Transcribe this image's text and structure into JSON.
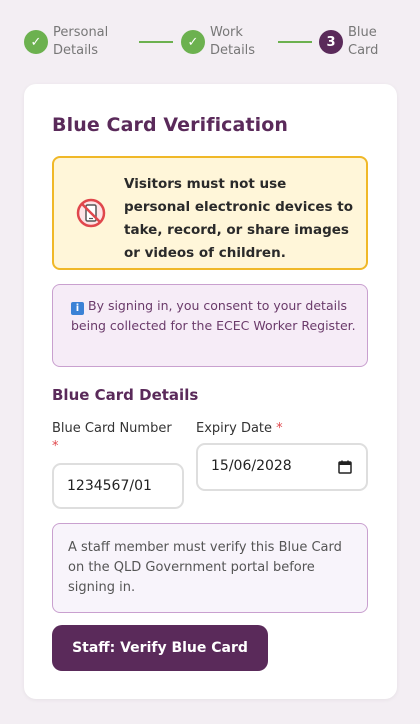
{
  "stepper": {
    "steps": [
      {
        "line1": "Personal",
        "line2": "Details",
        "status": "done",
        "marker": "✓"
      },
      {
        "line1": "Work",
        "line2": "Details",
        "status": "done",
        "marker": "✓"
      },
      {
        "line1": "Blue",
        "line2": "Card",
        "status": "active",
        "marker": "3"
      }
    ]
  },
  "card": {
    "title": "Blue Card Verification",
    "warning": {
      "icon": "no-phone-icon",
      "text": "Visitors must not use personal electronic devices to take, record, or share images or videos of children."
    },
    "consent": {
      "icon": "info-icon",
      "icon_glyph": "i",
      "text": "By signing in, you consent to your details being collected for the ECEC Worker Register."
    },
    "section_title": "Blue Card Details",
    "blue_card_number": {
      "label": "Blue Card Number",
      "required_mark": "*",
      "value": "1234567/01"
    },
    "expiry_date": {
      "label": "Expiry Date",
      "required_mark": "*",
      "value": "15/06/2028"
    },
    "staff_note": "A staff member must verify this Blue Card on the QLD Government portal before signing in.",
    "verify_button_label": "Staff: Verify Blue Card"
  },
  "colors": {
    "brand": "#5a2a5a",
    "step_done": "#6cb14f",
    "warning_border": "#f0b828",
    "warning_bg": "#fff6d9",
    "consent_bg": "#f6ecf7",
    "required": "#e0474c"
  }
}
